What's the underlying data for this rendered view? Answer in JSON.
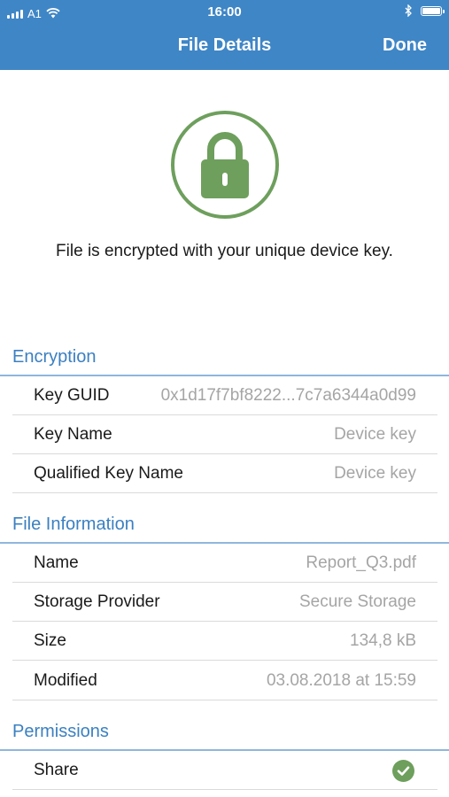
{
  "status_bar": {
    "carrier": "A1",
    "time": "16:00"
  },
  "nav": {
    "title": "File Details",
    "done_label": "Done"
  },
  "message": "File is encrypted with your unique device key.",
  "sections": {
    "encryption": {
      "title": "Encryption",
      "rows": [
        {
          "label": "Key GUID",
          "value": "0x1d17f7bf8222...7c7a6344a0d99"
        },
        {
          "label": "Key Name",
          "value": "Device key"
        },
        {
          "label": "Qualified Key Name",
          "value": "Device key"
        }
      ]
    },
    "file_information": {
      "title": "File Information",
      "rows": [
        {
          "label": "Name",
          "value": "Report_Q3.pdf"
        },
        {
          "label": "Storage Provider",
          "value": "Secure Storage"
        },
        {
          "label": "Size",
          "value": "134,8 kB"
        },
        {
          "label": "Modified",
          "value": "03.08.2018 at 15:59"
        }
      ]
    },
    "permissions": {
      "title": "Permissions",
      "rows": [
        {
          "label": "Share",
          "value_icon": "check-circle-icon"
        }
      ]
    }
  },
  "colors": {
    "accent": "#3f86c6",
    "section_header": "#3b80c1",
    "lock_green": "#6e9f5d",
    "check_green": "#6e9f5d"
  }
}
